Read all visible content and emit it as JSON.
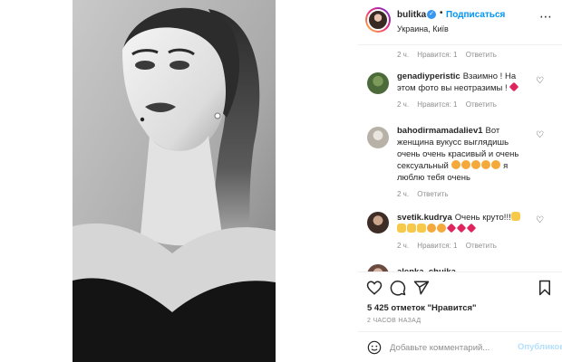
{
  "header": {
    "username": "bulitka",
    "separator": "•",
    "follow_label": "Подписаться",
    "location": "Украина, Київ",
    "more_icon": "more-horizontal-icon"
  },
  "caption_meta": {
    "time": "2 ч.",
    "likes": "Нравится: 1",
    "reply": "Ответить"
  },
  "comments": [
    {
      "username": "genadiyperistic",
      "text": "Взаимно ! На этом фото вы неотразимы !",
      "meta": {
        "time": "2 ч.",
        "likes": "Нравится: 1",
        "reply": "Ответить"
      }
    },
    {
      "username": "bahodirmamadaliev1",
      "text": "Вот женщина вукусс выглядишь очень очень красивый и очень сексуальный",
      "text_after": "я люблю тебя очень",
      "meta": {
        "time": "2 ч.",
        "reply": "Ответить"
      }
    },
    {
      "username": "svetik.kudrya",
      "text": "Очень круто!!!",
      "meta": {
        "time": "2 ч.",
        "likes": "Нравится: 1",
        "reply": "Ответить"
      }
    },
    {
      "username": "alenka_chuika"
    }
  ],
  "actions": {
    "likes_count": "5 425",
    "likes_text": "отметок \"Нравится\"",
    "time_ago": "2 часов назад"
  },
  "add_comment": {
    "placeholder": "Добавьте комментарий...",
    "publish_label": "Опубликовать"
  },
  "colors": {
    "accent": "#0095f6",
    "verified": "#3897f0",
    "heart_red": "#e0245e",
    "muted": "#8e8e8e",
    "publish_disabled": "#b2dffc"
  }
}
